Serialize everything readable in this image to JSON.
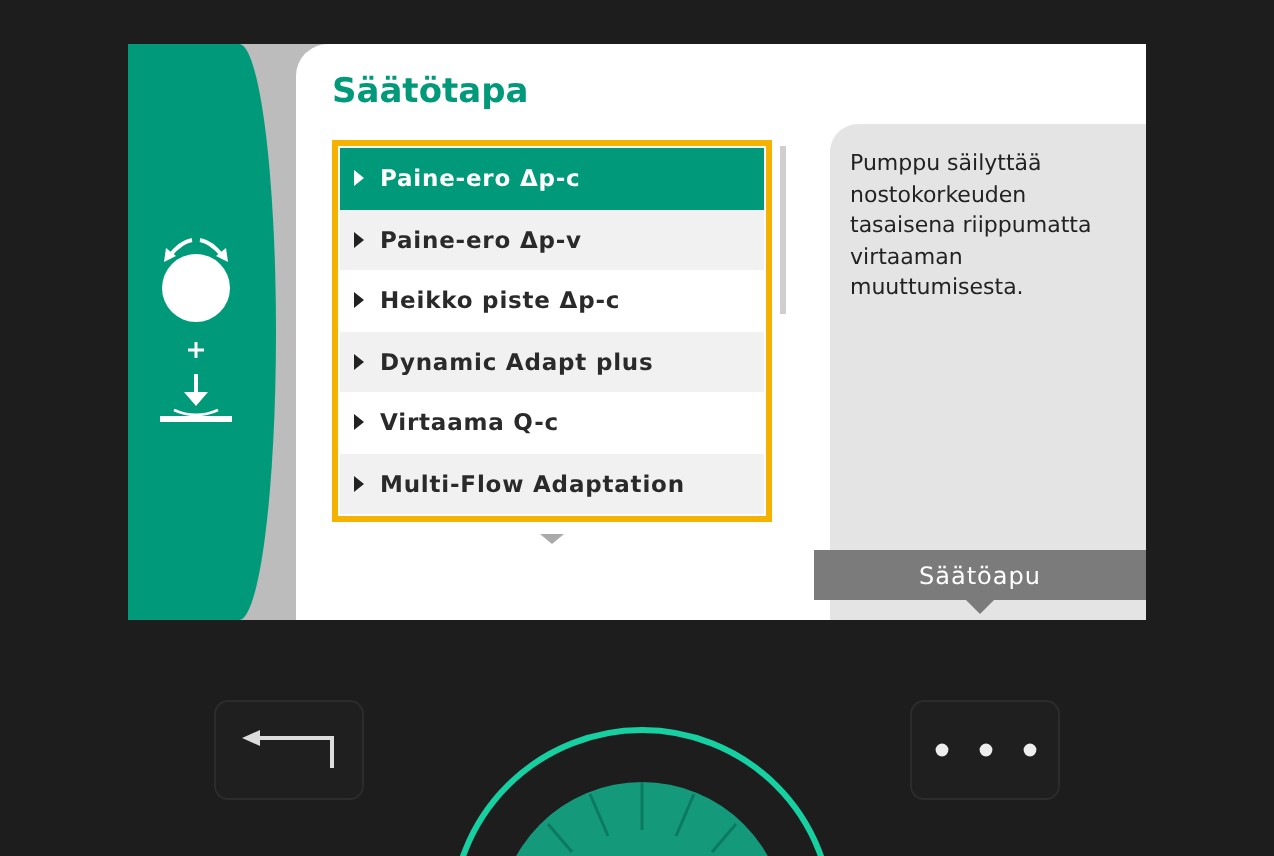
{
  "screen": {
    "title": "Säätötapa",
    "options": [
      {
        "label": "Paine-ero Δp-c",
        "selected": true
      },
      {
        "label": "Paine-ero Δp-v",
        "selected": false
      },
      {
        "label": "Heikko piste Δp-c",
        "selected": false
      },
      {
        "label": "Dynamic Adapt plus",
        "selected": false
      },
      {
        "label": "Virtaama Q-c",
        "selected": false
      },
      {
        "label": "Multi-Flow Adaptation",
        "selected": false
      }
    ],
    "help_text": "Pumppu säilyttää nostokorkeuden tasaisena riippumatta virtaaman muuttumisesta.",
    "help_tab": "Säätöapu"
  }
}
